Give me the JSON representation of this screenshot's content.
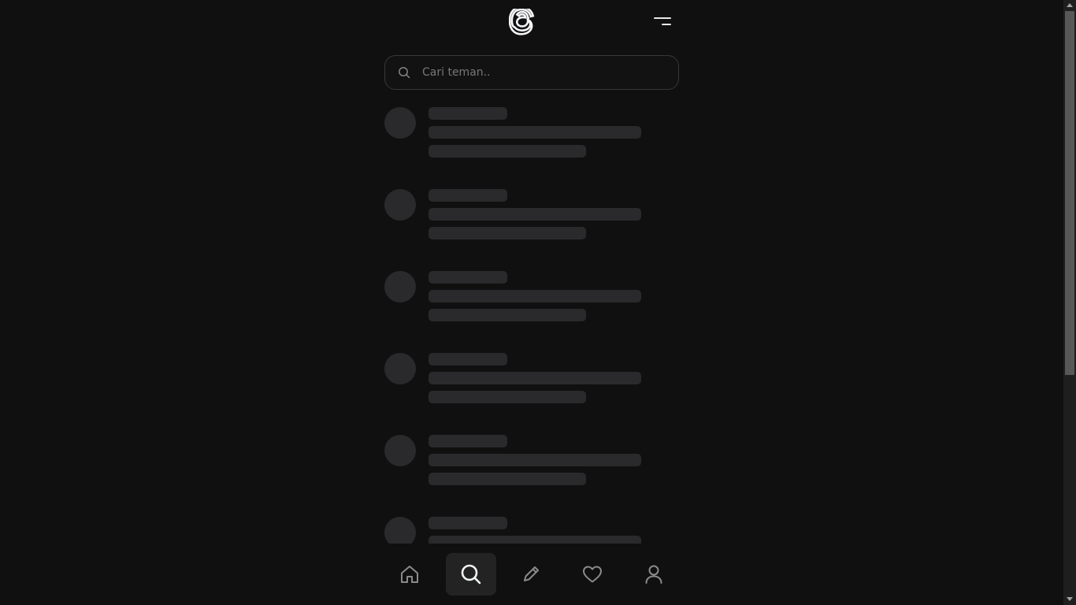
{
  "header": {
    "logo_icon": "threads-logo-icon",
    "menu_icon": "menu-icon"
  },
  "search": {
    "placeholder": "Cari teman..",
    "value": "",
    "icon": "search-icon"
  },
  "skeleton_items_count": 6,
  "bottom_nav": {
    "items": [
      {
        "icon": "home-icon",
        "active": false
      },
      {
        "icon": "search-icon",
        "active": true
      },
      {
        "icon": "pencil-icon",
        "active": false
      },
      {
        "icon": "heart-icon",
        "active": false
      },
      {
        "icon": "user-icon",
        "active": false
      }
    ]
  },
  "colors": {
    "background": "#101010",
    "skeleton": "#2a2a2c",
    "active_nav": "#232323",
    "border": "#383838"
  }
}
